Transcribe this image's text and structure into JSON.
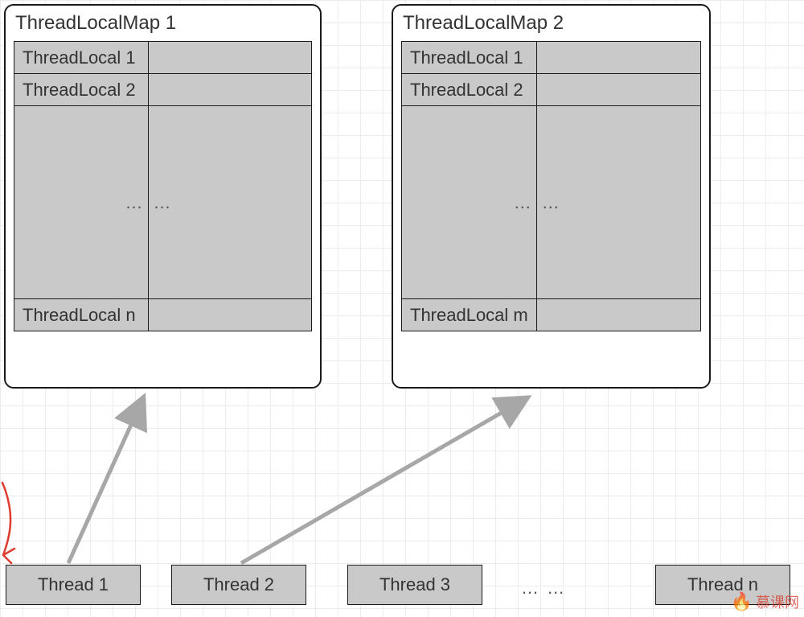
{
  "maps": {
    "left": {
      "title": "ThreadLocalMap 1",
      "rowA": "ThreadLocal 1",
      "rowB": "ThreadLocal 2",
      "rowN": "ThreadLocal n",
      "dotsL": "…",
      "dotsR": "…"
    },
    "right": {
      "title": "ThreadLocalMap 2",
      "rowA": "ThreadLocal 1",
      "rowB": "ThreadLocal 2",
      "rowN": "ThreadLocal m",
      "dotsL": "…",
      "dotsR": "…"
    }
  },
  "threads": {
    "t1": "Thread 1",
    "t2": "Thread 2",
    "t3": "Thread 3",
    "tn": "Thread n",
    "between": "… …"
  },
  "watermark": "慕课网"
}
